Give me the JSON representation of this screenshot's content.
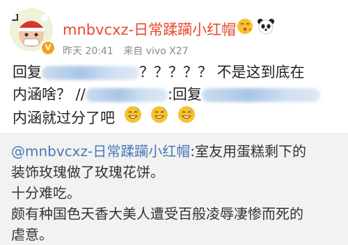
{
  "post": {
    "username": "mnbvcxz-日常蹂躏小红帽",
    "name_icons": [
      "kissing-face-icon",
      "panda-icon"
    ],
    "verified_badge": "V",
    "time": "昨天 20:41",
    "source": "来自 vivo X27",
    "body": {
      "line1_prefix": "回复",
      "line1_suffix": "？？？？？ 不是这到底在",
      "line2_prefix": "内涵啥？ //",
      "line2_suffix": ":回复",
      "line3_text": "内涵就过分了吧",
      "line3_icons": [
        "grinning-sweat-icon",
        "grinning-sweat-icon",
        "grinning-sweat-icon"
      ]
    }
  },
  "repost": {
    "mention": "@mnbvcxz-日常蹂躏小红帽",
    "line1_rest": ":室友用蛋糕剩下的",
    "line2": "装饰玫瑰做了玫瑰花饼。",
    "line3": "十分难吃。",
    "line4": "颇有种国色天香大美人遭受百般凌辱凄惨而死的",
    "line5": "虐意。"
  },
  "colors": {
    "username": "#e8492d",
    "mention": "#4a78b5",
    "meta": "#888888",
    "repost_bg": "#f2f2f2",
    "badge": "#f4a21b"
  }
}
